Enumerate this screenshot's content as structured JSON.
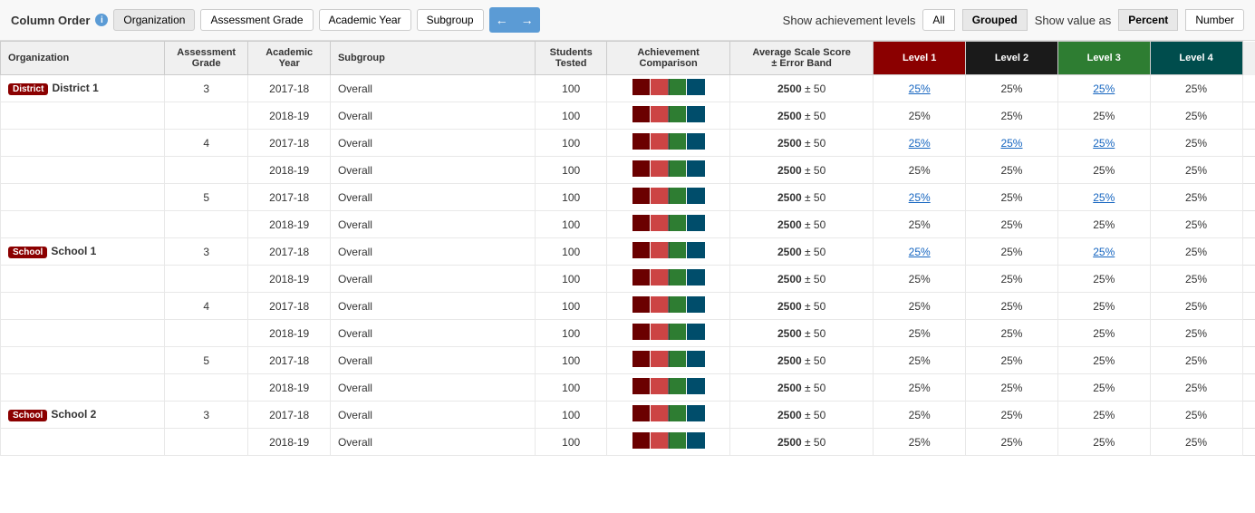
{
  "toolbar": {
    "column_order_label": "Column Order",
    "info_icon": "i",
    "buttons": [
      "Organization",
      "Assessment Grade",
      "Academic Year",
      "Subgroup"
    ],
    "prev_icon": "←",
    "next_icon": "→",
    "show_achievement_label": "Show achievement levels",
    "achievement_toggles": [
      "All",
      "Grouped"
    ],
    "show_value_label": "Show value as",
    "value_toggles": [
      "Percent",
      "Number"
    ],
    "active_achievement": "Grouped",
    "active_value": "Percent"
  },
  "headers": {
    "organization": "Organization",
    "assessment_grade": "Assessment Grade",
    "academic_year": "Academic Year",
    "subgroup": "Subgroup",
    "students_tested": "Students Tested",
    "achievement_comparison": "Achievement Comparison",
    "average_scale_score": "Average Scale Score ± Error Band",
    "level1": "Level 1",
    "level2": "Level 2",
    "level3": "Level 3",
    "level4": "Level 4"
  },
  "rows": [
    {
      "org_type": "district",
      "org_badge": "District",
      "org_name": "District 1",
      "grade": "3",
      "year": "2017-18",
      "subgroup": "Overall",
      "students": "100",
      "scale_score": "2500",
      "error_band": "50",
      "l1": "25%",
      "l2": "25%",
      "l3": "25%",
      "l4": "25%",
      "l1_link": true,
      "l2_link": false,
      "l3_link": true,
      "l4_link": false
    },
    {
      "org_type": "",
      "org_badge": "",
      "org_name": "",
      "grade": "",
      "year": "2018-19",
      "subgroup": "Overall",
      "students": "100",
      "scale_score": "2500",
      "error_band": "50",
      "l1": "25%",
      "l2": "25%",
      "l3": "25%",
      "l4": "25%",
      "l1_link": false,
      "l2_link": false,
      "l3_link": false,
      "l4_link": false
    },
    {
      "org_type": "",
      "org_badge": "",
      "org_name": "",
      "grade": "4",
      "year": "2017-18",
      "subgroup": "Overall",
      "students": "100",
      "scale_score": "2500",
      "error_band": "50",
      "l1": "25%",
      "l2": "25%",
      "l3": "25%",
      "l4": "25%",
      "l1_link": true,
      "l2_link": true,
      "l3_link": true,
      "l4_link": false
    },
    {
      "org_type": "",
      "org_badge": "",
      "org_name": "",
      "grade": "",
      "year": "2018-19",
      "subgroup": "Overall",
      "students": "100",
      "scale_score": "2500",
      "error_band": "50",
      "l1": "25%",
      "l2": "25%",
      "l3": "25%",
      "l4": "25%",
      "l1_link": false,
      "l2_link": false,
      "l3_link": false,
      "l4_link": false
    },
    {
      "org_type": "",
      "org_badge": "",
      "org_name": "",
      "grade": "5",
      "year": "2017-18",
      "subgroup": "Overall",
      "students": "100",
      "scale_score": "2500",
      "error_band": "50",
      "l1": "25%",
      "l2": "25%",
      "l3": "25%",
      "l4": "25%",
      "l1_link": true,
      "l2_link": false,
      "l3_link": true,
      "l4_link": false
    },
    {
      "org_type": "",
      "org_badge": "",
      "org_name": "",
      "grade": "",
      "year": "2018-19",
      "subgroup": "Overall",
      "students": "100",
      "scale_score": "2500",
      "error_band": "50",
      "l1": "25%",
      "l2": "25%",
      "l3": "25%",
      "l4": "25%",
      "l1_link": false,
      "l2_link": false,
      "l3_link": false,
      "l4_link": false
    },
    {
      "org_type": "school",
      "org_badge": "School",
      "org_name": "School 1",
      "grade": "3",
      "year": "2017-18",
      "subgroup": "Overall",
      "students": "100",
      "scale_score": "2500",
      "error_band": "50",
      "l1": "25%",
      "l2": "25%",
      "l3": "25%",
      "l4": "25%",
      "l1_link": true,
      "l2_link": false,
      "l3_link": true,
      "l4_link": false
    },
    {
      "org_type": "",
      "org_badge": "",
      "org_name": "",
      "grade": "",
      "year": "2018-19",
      "subgroup": "Overall",
      "students": "100",
      "scale_score": "2500",
      "error_band": "50",
      "l1": "25%",
      "l2": "25%",
      "l3": "25%",
      "l4": "25%",
      "l1_link": false,
      "l2_link": false,
      "l3_link": false,
      "l4_link": false
    },
    {
      "org_type": "",
      "org_badge": "",
      "org_name": "",
      "grade": "4",
      "year": "2017-18",
      "subgroup": "Overall",
      "students": "100",
      "scale_score": "2500",
      "error_band": "50",
      "l1": "25%",
      "l2": "25%",
      "l3": "25%",
      "l4": "25%",
      "l1_link": false,
      "l2_link": false,
      "l3_link": false,
      "l4_link": false
    },
    {
      "org_type": "",
      "org_badge": "",
      "org_name": "",
      "grade": "",
      "year": "2018-19",
      "subgroup": "Overall",
      "students": "100",
      "scale_score": "2500",
      "error_band": "50",
      "l1": "25%",
      "l2": "25%",
      "l3": "25%",
      "l4": "25%",
      "l1_link": false,
      "l2_link": false,
      "l3_link": false,
      "l4_link": false
    },
    {
      "org_type": "",
      "org_badge": "",
      "org_name": "",
      "grade": "5",
      "year": "2017-18",
      "subgroup": "Overall",
      "students": "100",
      "scale_score": "2500",
      "error_band": "50",
      "l1": "25%",
      "l2": "25%",
      "l3": "25%",
      "l4": "25%",
      "l1_link": false,
      "l2_link": false,
      "l3_link": false,
      "l4_link": false
    },
    {
      "org_type": "",
      "org_badge": "",
      "org_name": "",
      "grade": "",
      "year": "2018-19",
      "subgroup": "Overall",
      "students": "100",
      "scale_score": "2500",
      "error_band": "50",
      "l1": "25%",
      "l2": "25%",
      "l3": "25%",
      "l4": "25%",
      "l1_link": false,
      "l2_link": false,
      "l3_link": false,
      "l4_link": false
    },
    {
      "org_type": "school",
      "org_badge": "School",
      "org_name": "School 2",
      "grade": "3",
      "year": "2017-18",
      "subgroup": "Overall",
      "students": "100",
      "scale_score": "2500",
      "error_band": "50",
      "l1": "25%",
      "l2": "25%",
      "l3": "25%",
      "l4": "25%",
      "l1_link": false,
      "l2_link": false,
      "l3_link": false,
      "l4_link": false
    },
    {
      "org_type": "",
      "org_badge": "",
      "org_name": "",
      "grade": "",
      "year": "2018-19",
      "subgroup": "Overall",
      "students": "100",
      "scale_score": "2500",
      "error_band": "50",
      "l1": "25%",
      "l2": "25%",
      "l3": "25%",
      "l4": "25%",
      "l1_link": false,
      "l2_link": false,
      "l3_link": false,
      "l4_link": false
    }
  ],
  "colors": {
    "level1_dark": "#6B0000",
    "level1_light": "#8B0000",
    "level2": "#cc0000",
    "level3_light": "#2e7d32",
    "level3_dark": "#1b5e20",
    "level4": "#004d4d",
    "divider": "#ffffff"
  }
}
